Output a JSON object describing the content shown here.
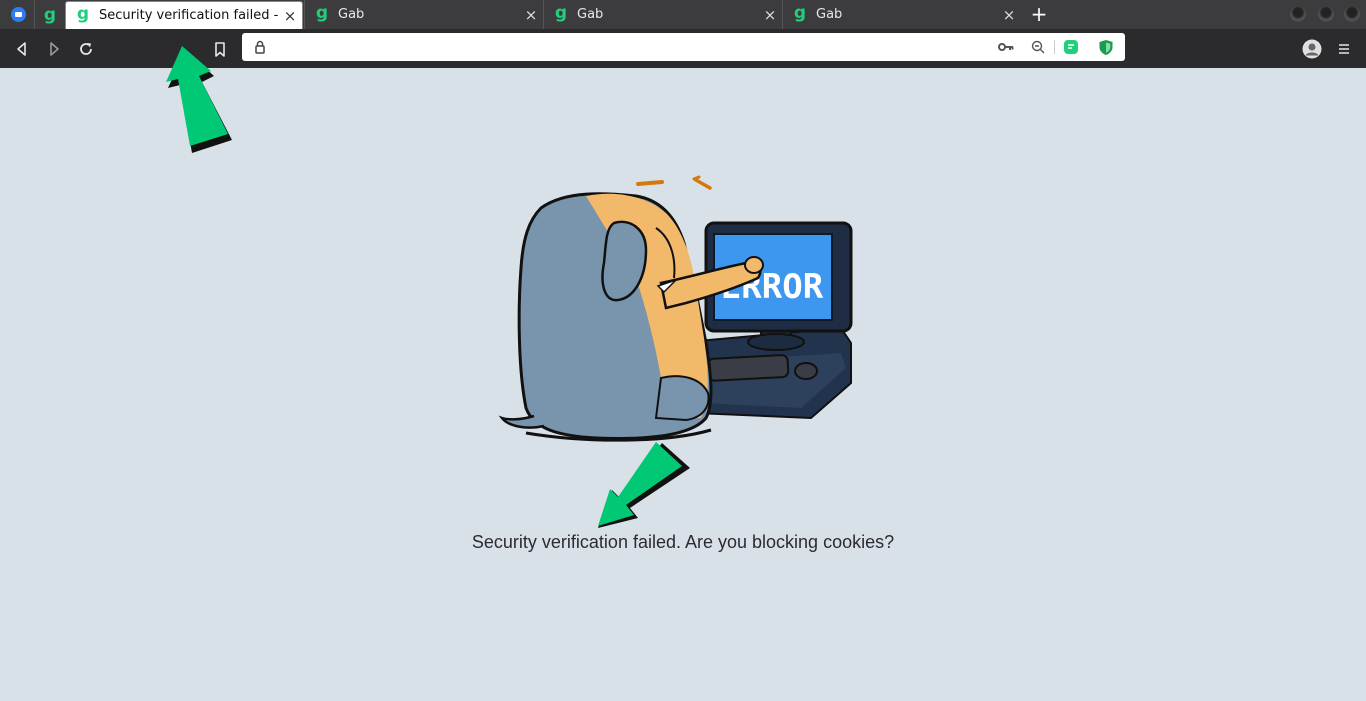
{
  "browser": {
    "tabs": [
      {
        "title": "Security verification failed -",
        "active": true
      },
      {
        "title": "Gab",
        "active": false
      },
      {
        "title": "Gab",
        "active": false
      },
      {
        "title": "Gab",
        "active": false
      }
    ],
    "tab_icon": "g-logo-icon",
    "new_tab_label": "+",
    "close_label": "×",
    "pinned_g_label": "g"
  },
  "screen_text": "ERROR",
  "page": {
    "message": "Security verification failed. Are you blocking cookies?"
  },
  "colors": {
    "background": "#d9e1e8",
    "gab_green": "#21cf7a",
    "annotation_arrow": "#00c874",
    "screen_blue": "#3d97ee"
  }
}
